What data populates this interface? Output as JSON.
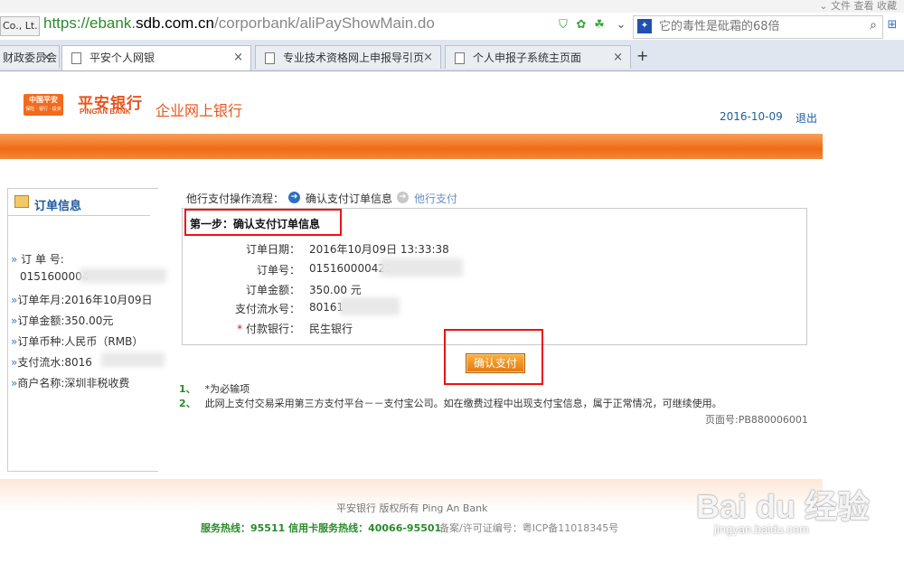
{
  "browser": {
    "top_menu": "⌄  文件   查看   收藏",
    "prev_tab_chip": "Co., Lt...",
    "url_host_pre": "https://ebank.",
    "url_host": "sdb.com.cn",
    "url_path": "/corporbank/aliPayShowMain.do",
    "search_placeholder": "它的毒性是砒霜的68倍",
    "tabs": [
      {
        "label": "财政委员会"
      },
      {
        "label": "平安个人网银"
      },
      {
        "label": "专业技术资格网上申报导引页"
      },
      {
        "label": "个人申报子系统主页面"
      }
    ],
    "new_tab": "+"
  },
  "header": {
    "logo_badge": "中国平安",
    "logo_sub": "保险 · 银行 · 投资",
    "bank_name_cn": "平安银行",
    "bank_name_en": "PINGAN BANK",
    "portal_title": "企业网上银行",
    "date": "2016-10-09",
    "logout": "退出"
  },
  "sidebar": {
    "title": "订单信息",
    "rows": [
      {
        "label": "订 单 号:",
        "value": ""
      },
      {
        "label": "",
        "value": "0151600004"
      },
      {
        "label": "订单年月:",
        "value": "2016年10月09日"
      },
      {
        "label": "订单金额:",
        "value": "350.00元"
      },
      {
        "label": "订单币种:",
        "value": "人民币（RMB）"
      },
      {
        "label": "支付流水:",
        "value": "8016"
      },
      {
        "label": "商户名称:",
        "value": "深圳非税收费"
      }
    ]
  },
  "process": {
    "label": "他行支付操作流程：",
    "step1": "确认支付订单信息",
    "step2": "他行支付"
  },
  "form": {
    "step_title": "第一步：确认支付订单信息",
    "fields": [
      {
        "label": "订单日期：",
        "value": "2016年10月09日  13:33:38"
      },
      {
        "label": "订单号：",
        "value": "015160000425"
      },
      {
        "label": "订单金额：",
        "value": "350.00 元"
      },
      {
        "label": "支付流水号：",
        "value": "80161"
      },
      {
        "label": "付款银行：",
        "value": "民生银行",
        "required_mark": "*"
      }
    ],
    "confirm_label": "确认支付"
  },
  "notes": [
    {
      "num": "1、",
      "text": "*为必输项"
    },
    {
      "num": "2、",
      "text": "此网上支付交易采用第三方支付平台－－支付宝公司。如在缴费过程中出现支付宝信息，属于正常情况，可继续使用。"
    }
  ],
  "page_no": "页面号:PB880006001",
  "footer": {
    "copyright": "平安银行 版权所有 Ping An Bank",
    "hotline": "服务热线：95511 信用卡服务热线：40066-95501",
    "icp": "备案/许可证编号：粤ICP备11018345号"
  },
  "watermark": {
    "big": "Bai du 经验",
    "small": "jingyan.baidu.com"
  },
  "colors": {
    "brand_orange": "#ef6a14",
    "link_blue": "#205d9c",
    "highlight_red": "#e11111",
    "note_green": "#2b8a2b"
  }
}
